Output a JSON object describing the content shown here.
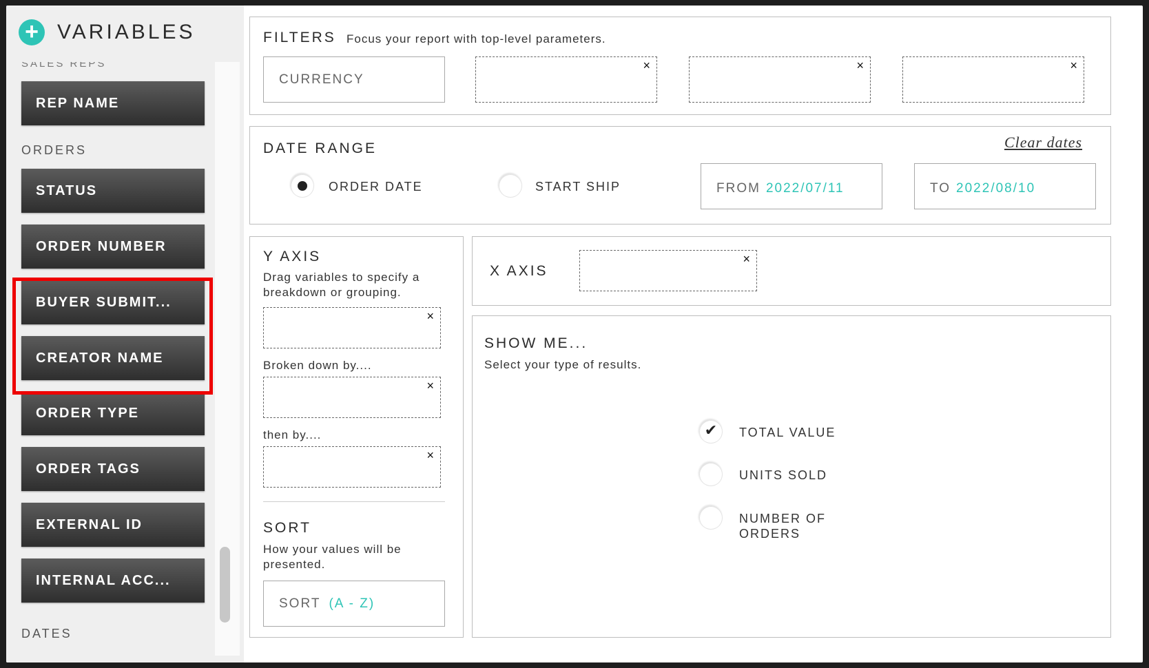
{
  "sidebar": {
    "title": "VARIABLES",
    "cut_off_section": "SALES REPS",
    "items_top": [
      {
        "label": "REP NAME"
      }
    ],
    "orders_section": "ORDERS",
    "orders": [
      {
        "label": "STATUS"
      },
      {
        "label": "ORDER NUMBER"
      },
      {
        "label": "BUYER SUBMIT..."
      },
      {
        "label": "CREATOR NAME"
      },
      {
        "label": "ORDER TYPE"
      },
      {
        "label": "ORDER TAGS"
      },
      {
        "label": "EXTERNAL ID"
      },
      {
        "label": "INTERNAL ACC..."
      }
    ],
    "dates_section": "DATES"
  },
  "filters": {
    "title": "FILTERS",
    "subtitle": "Focus your report with top-level parameters.",
    "currency_label": "CURRENCY",
    "remove_icon": "×"
  },
  "date_range": {
    "title": "DATE RANGE",
    "clear_label": "Clear dates",
    "option_order_date": "ORDER DATE",
    "option_start_ship": "START SHIP",
    "selected": "ORDER DATE",
    "from_label": "FROM",
    "from_value": "2022/07/11",
    "to_label": "TO",
    "to_value": "2022/08/10"
  },
  "y_axis": {
    "title": "Y AXIS",
    "subtitle": "Drag variables to specify a breakdown or grouping.",
    "broken_down_label": "Broken down by....",
    "then_by_label": "then by...."
  },
  "sort": {
    "title": "SORT",
    "subtitle": "How your values will be presented.",
    "label": "SORT",
    "value": "(A - Z)"
  },
  "x_axis": {
    "title": "X AXIS"
  },
  "show_me": {
    "title": "SHOW ME...",
    "subtitle": "Select your type of results.",
    "options": [
      {
        "label": "TOTAL VALUE",
        "selected": true
      },
      {
        "label": "UNITS SOLD",
        "selected": false
      },
      {
        "label": "NUMBER OF",
        "label2": "ORDERS",
        "selected": false
      }
    ]
  },
  "colors": {
    "accent": "#2ec4b6",
    "highlight": "#ee0000",
    "button_dark": "#3a3a3a"
  }
}
